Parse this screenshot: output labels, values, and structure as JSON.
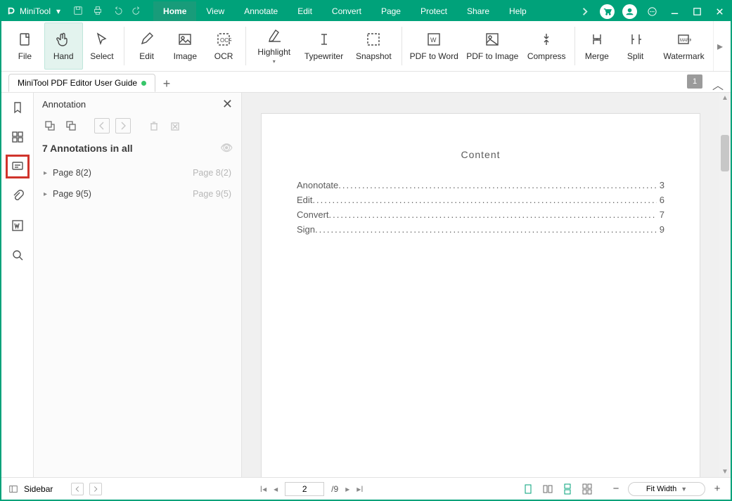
{
  "title_brand": "MiniTool",
  "menus": [
    "Home",
    "View",
    "Annotate",
    "Edit",
    "Convert",
    "Page",
    "Protect",
    "Share",
    "Help"
  ],
  "active_menu": 0,
  "ribbon": {
    "groups": [
      [
        "File",
        "Hand",
        "Select"
      ],
      [
        "Edit",
        "Image",
        "OCR"
      ],
      [
        "Highlight",
        "Typewriter",
        "Snapshot"
      ],
      [
        "PDF to Word",
        "PDF to Image",
        "Compress"
      ],
      [
        "Merge",
        "Split",
        "Watermark"
      ]
    ],
    "active_tool": "Hand"
  },
  "doc_tab": {
    "label": "MiniTool PDF Editor User Guide"
  },
  "page_badge": "1",
  "side": {
    "title": "Annotation",
    "summary": "7 Annotations in all",
    "rows": [
      {
        "label": "Page 8(2)",
        "hint": "Page 8(2)"
      },
      {
        "label": "Page 9(5)",
        "hint": "Page 9(5)"
      }
    ]
  },
  "document": {
    "title": "Content",
    "toc": [
      {
        "label": "Anonotate",
        "page": "3"
      },
      {
        "label": "Edit",
        "page": "6"
      },
      {
        "label": "Convert",
        "page": "7"
      },
      {
        "label": "Sign",
        "page": "9"
      }
    ]
  },
  "status": {
    "sidebar_label": "Sidebar",
    "current_page": "2",
    "total_pages": "/9",
    "zoom_label": "Fit Width"
  }
}
